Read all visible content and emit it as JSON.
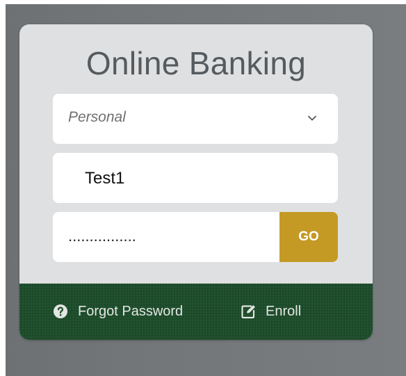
{
  "login": {
    "title": "Online Banking",
    "account_type": {
      "selected": "Personal"
    },
    "username": {
      "value": "Test1"
    },
    "password": {
      "masked_value": "................"
    },
    "go_label": "GO"
  },
  "footer": {
    "forgot_label": "Forgot Password",
    "enroll_label": "Enroll"
  },
  "icons": {
    "chevron": "chevron-down-icon",
    "forgot": "question-circle-icon",
    "enroll": "edit-icon"
  },
  "colors": {
    "accent_gold": "#c49a25",
    "footer_green": "#1c4b2a",
    "card_background": "#dfe0e1",
    "title_text": "#555a5e"
  }
}
